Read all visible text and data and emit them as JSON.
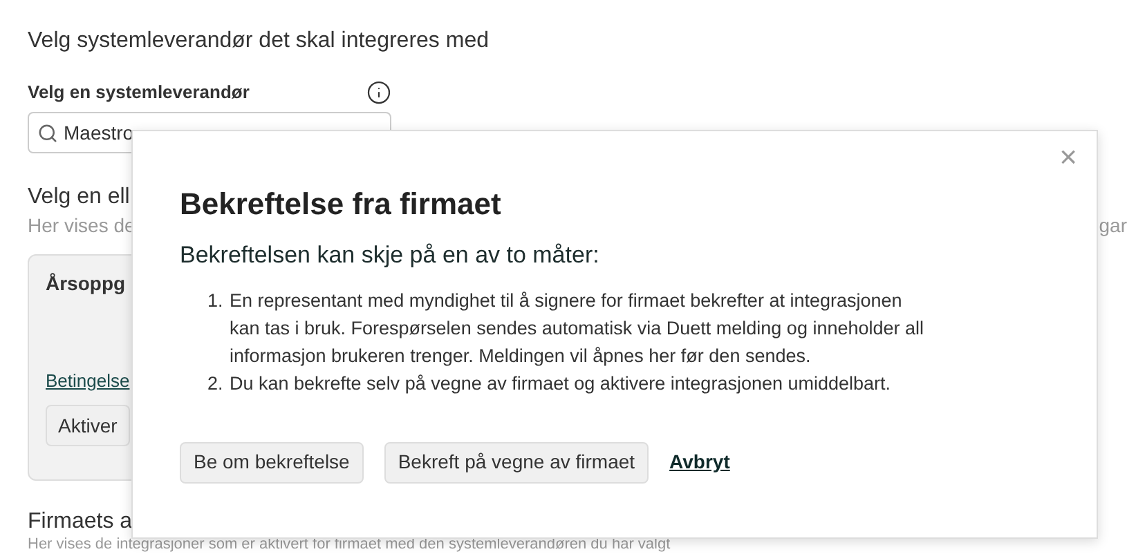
{
  "page": {
    "heading": "Velg systemleverandør det skal integreres med",
    "vendor_label": "Velg en systemleverandør",
    "vendor_search": {
      "value": "Maestro"
    },
    "section_title": "Velg en ell",
    "section_hint": "Her vises de",
    "section_hint_end": "gar",
    "card": {
      "title": "Årsoppg",
      "link": "Betingelse",
      "button": "Aktiver"
    },
    "active_title": "Firmaets a",
    "active_hint": "Her vises de integrasjoner som er aktivert for firmaet med den systemleverandøren du har valgt"
  },
  "dialog": {
    "close": "×",
    "title": "Bekreftelse fra firmaet",
    "subtitle": "Bekreftelsen kan skje på en av to måter:",
    "steps": [
      {
        "number": "1.",
        "text": "En representant med myndighet til å signere for firmaet bekrefter at integrasjonen kan tas i bruk. Forespørselen sendes automatisk via Duett melding og inneholder all informasjon brukeren trenger. Meldingen vil åpnes her før den sendes."
      },
      {
        "number": "2.",
        "text": "Du kan bekrefte selv på vegne av firmaet og aktivere integrasjonen umiddelbart."
      }
    ],
    "buttons": [
      {
        "label": "Be om bekreftelse",
        "kind": "button"
      },
      {
        "label": "Bekreft på vegne av firmaet",
        "kind": "button"
      },
      {
        "label": "Avbryt",
        "kind": "link"
      }
    ]
  }
}
